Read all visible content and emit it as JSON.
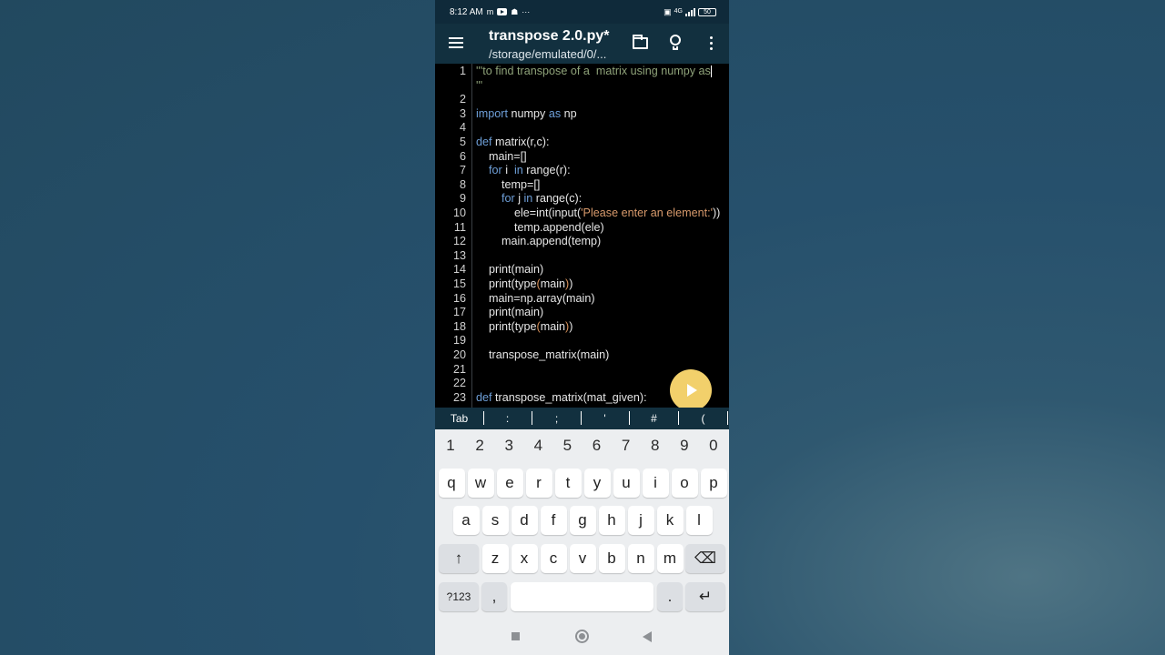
{
  "status_bar": {
    "time": "8:12 AM",
    "battery": "50",
    "network": "4G"
  },
  "app_bar": {
    "title": "transpose 2.0.py*",
    "subtitle": "/storage/emulated/0/..."
  },
  "editor": {
    "lines": [
      {
        "n": "1",
        "parts": [
          [
            "cmt",
            "'''to find transpose of a  matrix using numpy as"
          ]
        ],
        "cursor": true
      },
      {
        "n": "",
        "parts": [
          [
            "cmt",
            "'''"
          ]
        ]
      },
      {
        "n": "2",
        "parts": []
      },
      {
        "n": "3",
        "parts": [
          [
            "kw",
            "import"
          ],
          [
            "txt",
            " numpy "
          ],
          [
            "kw",
            "as"
          ],
          [
            "txt",
            " np"
          ]
        ]
      },
      {
        "n": "4",
        "parts": []
      },
      {
        "n": "5",
        "parts": [
          [
            "kw",
            "def"
          ],
          [
            "txt",
            " matrix(r,c):"
          ]
        ]
      },
      {
        "n": "6",
        "parts": [
          [
            "txt",
            "    main=[]"
          ]
        ]
      },
      {
        "n": "7",
        "parts": [
          [
            "txt",
            "    "
          ],
          [
            "kw",
            "for"
          ],
          [
            "txt",
            " i  "
          ],
          [
            "kw",
            "in"
          ],
          [
            "txt",
            " range(r):"
          ]
        ]
      },
      {
        "n": "8",
        "parts": [
          [
            "txt",
            "        temp=[]"
          ]
        ]
      },
      {
        "n": "9",
        "parts": [
          [
            "txt",
            "        "
          ],
          [
            "kw",
            "for"
          ],
          [
            "txt",
            " j "
          ],
          [
            "kw",
            "in"
          ],
          [
            "txt",
            " range(c):"
          ]
        ]
      },
      {
        "n": "10",
        "parts": [
          [
            "txt",
            "            ele=int(input("
          ],
          [
            "str",
            "'Please enter an element:'"
          ],
          [
            "txt",
            "))"
          ]
        ]
      },
      {
        "n": "11",
        "parts": [
          [
            "txt",
            "            temp.append(ele)"
          ]
        ]
      },
      {
        "n": "12",
        "parts": [
          [
            "txt",
            "        main.append(temp)"
          ]
        ]
      },
      {
        "n": "13",
        "parts": []
      },
      {
        "n": "14",
        "parts": [
          [
            "txt",
            "    print(main)"
          ]
        ]
      },
      {
        "n": "15",
        "parts": [
          [
            "txt",
            "    print(type"
          ],
          [
            "par",
            "("
          ],
          [
            "txt",
            "main"
          ],
          [
            "par",
            ")"
          ],
          [
            "txt",
            ")"
          ]
        ]
      },
      {
        "n": "16",
        "parts": [
          [
            "txt",
            "    main=np.array(main)"
          ]
        ]
      },
      {
        "n": "17",
        "parts": [
          [
            "txt",
            "    print(main)"
          ]
        ]
      },
      {
        "n": "18",
        "parts": [
          [
            "txt",
            "    print(type"
          ],
          [
            "par",
            "("
          ],
          [
            "txt",
            "main"
          ],
          [
            "par",
            ")"
          ],
          [
            "txt",
            ")"
          ]
        ]
      },
      {
        "n": "19",
        "parts": []
      },
      {
        "n": "20",
        "parts": [
          [
            "txt",
            "    transpose_matrix(main)"
          ]
        ]
      },
      {
        "n": "21",
        "parts": []
      },
      {
        "n": "22",
        "parts": []
      },
      {
        "n": "23",
        "parts": [
          [
            "kw",
            "def"
          ],
          [
            "txt",
            " transpose_matrix(mat_given):"
          ]
        ]
      }
    ]
  },
  "symbol_bar": [
    "Tab",
    ":",
    ";",
    "'",
    "#",
    "("
  ],
  "keyboard": {
    "numbers": [
      "1",
      "2",
      "3",
      "4",
      "5",
      "6",
      "7",
      "8",
      "9",
      "0"
    ],
    "row1": [
      "q",
      "w",
      "e",
      "r",
      "t",
      "y",
      "u",
      "i",
      "o",
      "p"
    ],
    "row2": [
      "a",
      "s",
      "d",
      "f",
      "g",
      "h",
      "j",
      "k",
      "l"
    ],
    "row3": [
      "z",
      "x",
      "c",
      "v",
      "b",
      "n",
      "m"
    ],
    "shift": "↑",
    "backspace": "⌫",
    "mode": "?123",
    "comma": ",",
    "period": ".",
    "enter": "↵"
  },
  "colors": {
    "appbar": "#12303f",
    "keyword": "#6e9fd8",
    "string": "#d89a6c",
    "comment": "#8fa37a",
    "run_button": "#f2d06b"
  }
}
